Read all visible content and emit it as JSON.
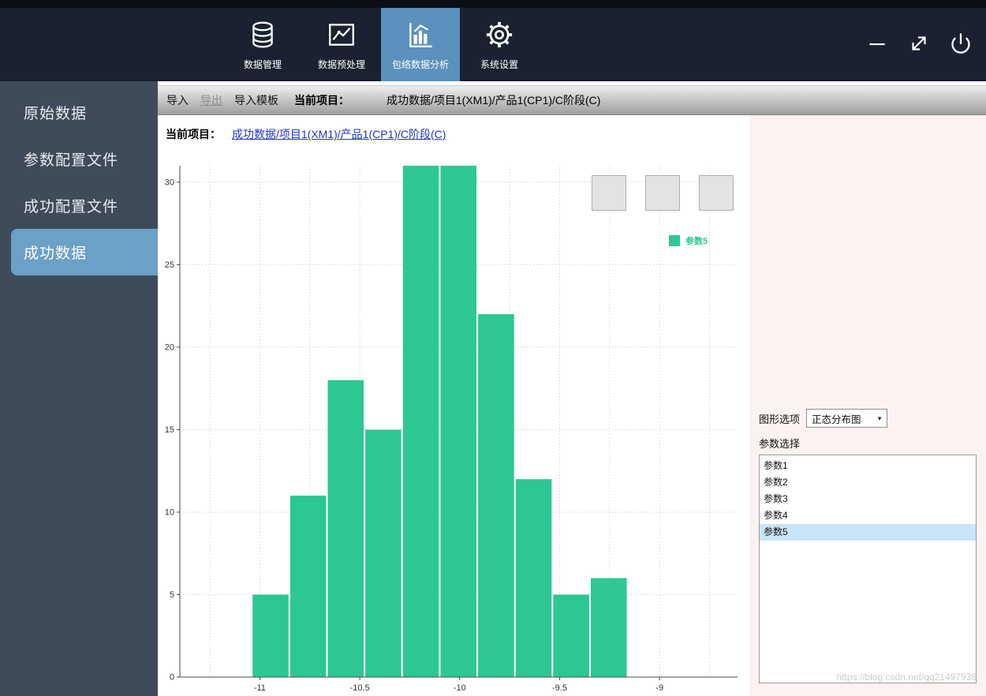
{
  "window_controls": [
    "minimize-icon",
    "maximize-icon",
    "power-icon"
  ],
  "topbar": {
    "items": [
      {
        "label": "数据管理",
        "icon": "database-icon",
        "active": false
      },
      {
        "label": "数据预处理",
        "icon": "line-chart-icon",
        "active": false
      },
      {
        "label": "包络数据分析",
        "icon": "bar-chart-icon",
        "active": true
      },
      {
        "label": "系统设置",
        "icon": "gear-icon",
        "active": false
      }
    ]
  },
  "sidebar": {
    "items": [
      {
        "label": "原始数据",
        "active": false
      },
      {
        "label": "参数配置文件",
        "active": false
      },
      {
        "label": "成功配置文件",
        "active": false
      },
      {
        "label": "成功数据",
        "active": true
      }
    ]
  },
  "toolbar": {
    "import_label": "导入",
    "export_label": "导出",
    "import_template_label": "导入模板",
    "current_project_label": "当前项目：",
    "current_project_value": "成功数据/项目1(XM1)/产品1(CP1)/C阶段(C)"
  },
  "content": {
    "current_project_label": "当前项目：",
    "current_project_link": "成功数据/项目1(XM1)/产品1(CP1)/C阶段(C)"
  },
  "options_panel": {
    "graph_option_label": "图形选项",
    "graph_type_value": "正态分布图",
    "param_select_label": "参数选择",
    "params": [
      {
        "label": "参数1",
        "selected": false
      },
      {
        "label": "参数2",
        "selected": false
      },
      {
        "label": "参数3",
        "selected": false
      },
      {
        "label": "参数4",
        "selected": false
      },
      {
        "label": "参数5",
        "selected": true
      }
    ]
  },
  "watermark": "https://blog.csdn.net/qq21497936",
  "colors": {
    "topbar_bg": "#1a2130",
    "active_tab": "#5b91bc",
    "sidebar_bg": "#3e4c5a",
    "sidebar_selected": "#6ba0c7",
    "bar_green": "#2dc795",
    "link_blue": "#2033cc",
    "selection_blue": "#c9e3f7",
    "panel_pink": "#fdf2f2"
  },
  "chart_data": {
    "type": "bar",
    "title": "",
    "xlabel": "",
    "ylabel": "",
    "legend": [
      {
        "label": "参数5"
      }
    ],
    "legend_position": "top-right",
    "grid": {
      "on": true,
      "x_start": -11.25,
      "x_step": 0.25
    },
    "bar_color": "#2dc795",
    "x_ticks": [
      -11,
      -10.5,
      -10,
      -9.5,
      -9
    ],
    "y_ticks": [
      0,
      5,
      10,
      15,
      20,
      25,
      30
    ],
    "xlim": [
      -11.4,
      -8.61
    ],
    "ylim": [
      0,
      31
    ],
    "bin_start": -11.04,
    "bin_width": 0.188,
    "counts": [
      5,
      11,
      18,
      15,
      31,
      31,
      22,
      12,
      5,
      6
    ]
  }
}
